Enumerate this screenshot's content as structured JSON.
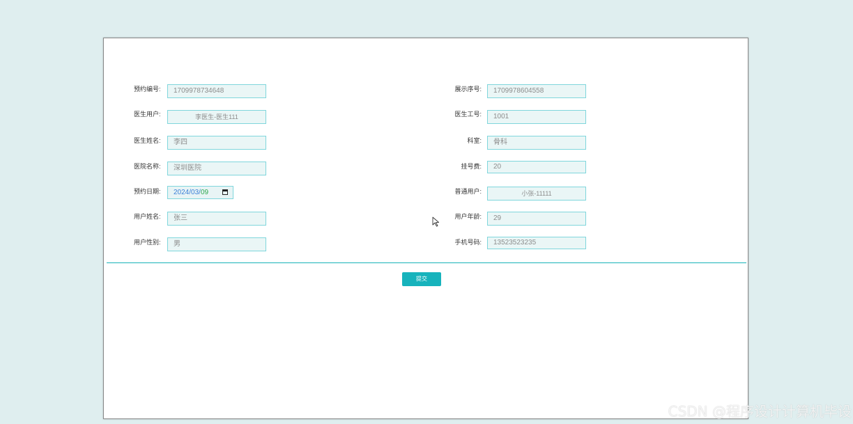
{
  "form": {
    "left": [
      {
        "label": "预约编号:",
        "value": "1709978734648"
      },
      {
        "label": "医生用户:",
        "value": "李医生-医生111"
      },
      {
        "label": "医生姓名:",
        "value": "李四"
      },
      {
        "label": "医院名称:",
        "value": "深圳医院"
      },
      {
        "label": "预约日期:",
        "date": {
          "year": "2024",
          "month": "03",
          "day": "09"
        }
      },
      {
        "label": "用户姓名:",
        "value": "张三"
      },
      {
        "label": "用户性别:",
        "value": "男"
      }
    ],
    "right": [
      {
        "label": "展示序号:",
        "value": "1709978604558"
      },
      {
        "label": "医生工号:",
        "value": "1001"
      },
      {
        "label": "科室:",
        "value": "骨科"
      },
      {
        "label": "挂号费:",
        "value": "20"
      },
      {
        "label": "普通用户:",
        "value": "小张-11111"
      },
      {
        "label": "用户年龄:",
        "value": "29"
      },
      {
        "label": "手机号码:",
        "value": "13523523235"
      }
    ],
    "submit_label": "提交"
  },
  "watermark": "CSDN @程序设计计算机毕设",
  "colors": {
    "accent": "#17b3bc",
    "field_border": "#7fd6dc",
    "field_bg": "#eaf6f6",
    "page_bg": "#dfeeef"
  },
  "icons": {
    "date_picker": "calendar-icon",
    "pointer": "mouse-cursor-icon"
  }
}
